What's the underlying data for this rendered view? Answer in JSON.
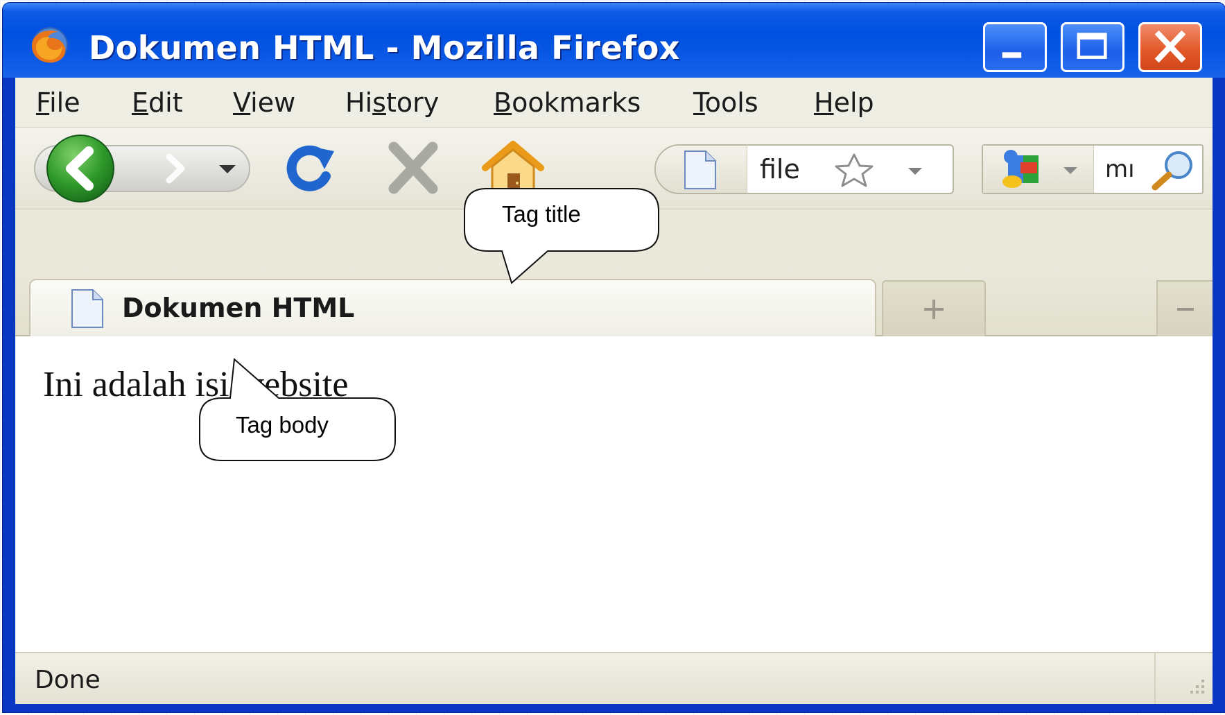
{
  "window": {
    "title": "Dokumen HTML - Mozilla Firefox",
    "app_icon": "firefox-icon",
    "controls": [
      "minimize-icon",
      "maximize-icon",
      "close-icon"
    ]
  },
  "menu": {
    "items": [
      {
        "label": "File",
        "mnemonic": "F"
      },
      {
        "label": "Edit",
        "mnemonic": "E"
      },
      {
        "label": "View",
        "mnemonic": "V"
      },
      {
        "label": "History",
        "mnemonic": "s"
      },
      {
        "label": "Bookmarks",
        "mnemonic": "B"
      },
      {
        "label": "Tools",
        "mnemonic": "T"
      },
      {
        "label": "Help",
        "mnemonic": "H"
      }
    ]
  },
  "navbar": {
    "buttons": [
      "back-arrow-icon",
      "forward-arrow-icon",
      "history-dropdown-icon",
      "reload-icon",
      "stop-icon",
      "home-icon"
    ],
    "url_value": "file",
    "search_value": "mı"
  },
  "tab": {
    "title": "Dokumen HTML"
  },
  "content": {
    "text": "Ini adalah isi website"
  },
  "status": {
    "text": "Done"
  },
  "callouts": {
    "title_label": "Tag title",
    "body_label": "Tag body"
  },
  "colors": {
    "titlebar": "#0050e0",
    "chrome": "#efeee4",
    "close_button": "#e35a2a"
  }
}
